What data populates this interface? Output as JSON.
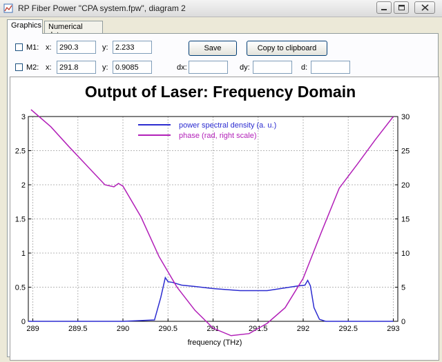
{
  "window": {
    "title": "RP Fiber Power \"CPA system.fpw\", diagram 2",
    "minimize_icon": "minimize-icon",
    "maximize_icon": "maximize-icon",
    "close_icon": "close-icon"
  },
  "tabs": [
    {
      "label": "Graphics",
      "active": true
    },
    {
      "label": "Numerical data",
      "active": false
    }
  ],
  "markers": {
    "m1": {
      "label": "M1:",
      "x_label": "x:",
      "x_value": "290.3",
      "y_label": "y:",
      "y_value": "2.233",
      "checked": false
    },
    "m2": {
      "label": "M2:",
      "x_label": "x:",
      "x_value": "291.8",
      "y_label": "y:",
      "y_value": "0.9085",
      "checked": false
    },
    "dx_label": "dx:",
    "dx_value": "",
    "dy_label": "dy:",
    "dy_value": "",
    "d_label": "d:",
    "d_value": ""
  },
  "buttons": {
    "save": "Save",
    "copy": "Copy to clipboard"
  },
  "chart_data": {
    "type": "line",
    "title": "Output of Laser: Frequency Domain",
    "xlabel": "frequency (THz)",
    "ylabel": "",
    "xlim": [
      288.95,
      293.05
    ],
    "ylim_left": [
      0,
      3
    ],
    "ylim_right": [
      0,
      30
    ],
    "x_ticks": [
      "289",
      "289.5",
      "290",
      "290.5",
      "291",
      "291.5",
      "292",
      "292.5",
      "293"
    ],
    "y_ticks_left": [
      "0",
      "0.5",
      "1",
      "1.5",
      "2",
      "2.5",
      "3"
    ],
    "y_ticks_right": [
      "0",
      "5",
      "10",
      "15",
      "20",
      "25",
      "30"
    ],
    "grid": true,
    "legend_position": "top-center",
    "colors": {
      "psd": "#2b2bd0",
      "phase": "#b21fb8"
    },
    "series": [
      {
        "name": "power spectral density (a. u.)",
        "axis": "left",
        "x": [
          288.95,
          289.5,
          290.0,
          290.35,
          290.42,
          290.47,
          290.5,
          290.55,
          290.6,
          290.65,
          290.8,
          291.0,
          291.3,
          291.6,
          291.85,
          291.95,
          292.02,
          292.05,
          292.08,
          292.12,
          292.18,
          292.25,
          292.5,
          292.75,
          293.0
        ],
        "y": [
          0.0,
          0.0,
          0.0,
          0.02,
          0.35,
          0.64,
          0.58,
          0.57,
          0.55,
          0.53,
          0.51,
          0.48,
          0.45,
          0.45,
          0.5,
          0.52,
          0.53,
          0.6,
          0.52,
          0.2,
          0.03,
          0.0,
          0.0,
          0.0,
          0.0
        ]
      },
      {
        "name": "phase (rad, right scale)",
        "axis": "right",
        "x": [
          288.98,
          289.2,
          289.4,
          289.6,
          289.8,
          289.9,
          289.95,
          290.0,
          290.2,
          290.4,
          290.6,
          290.8,
          291.0,
          291.2,
          291.4,
          291.6,
          291.8,
          292.0,
          292.2,
          292.4,
          292.6,
          292.8,
          293.0
        ],
        "y": [
          31.2,
          28.5,
          25.6,
          22.8,
          20.0,
          19.7,
          20.2,
          19.8,
          15.3,
          9.5,
          5.0,
          1.6,
          -1.0,
          -2.1,
          -1.8,
          -0.3,
          2.0,
          6.3,
          13.0,
          19.5,
          23.0,
          26.6,
          30.0
        ]
      }
    ]
  }
}
